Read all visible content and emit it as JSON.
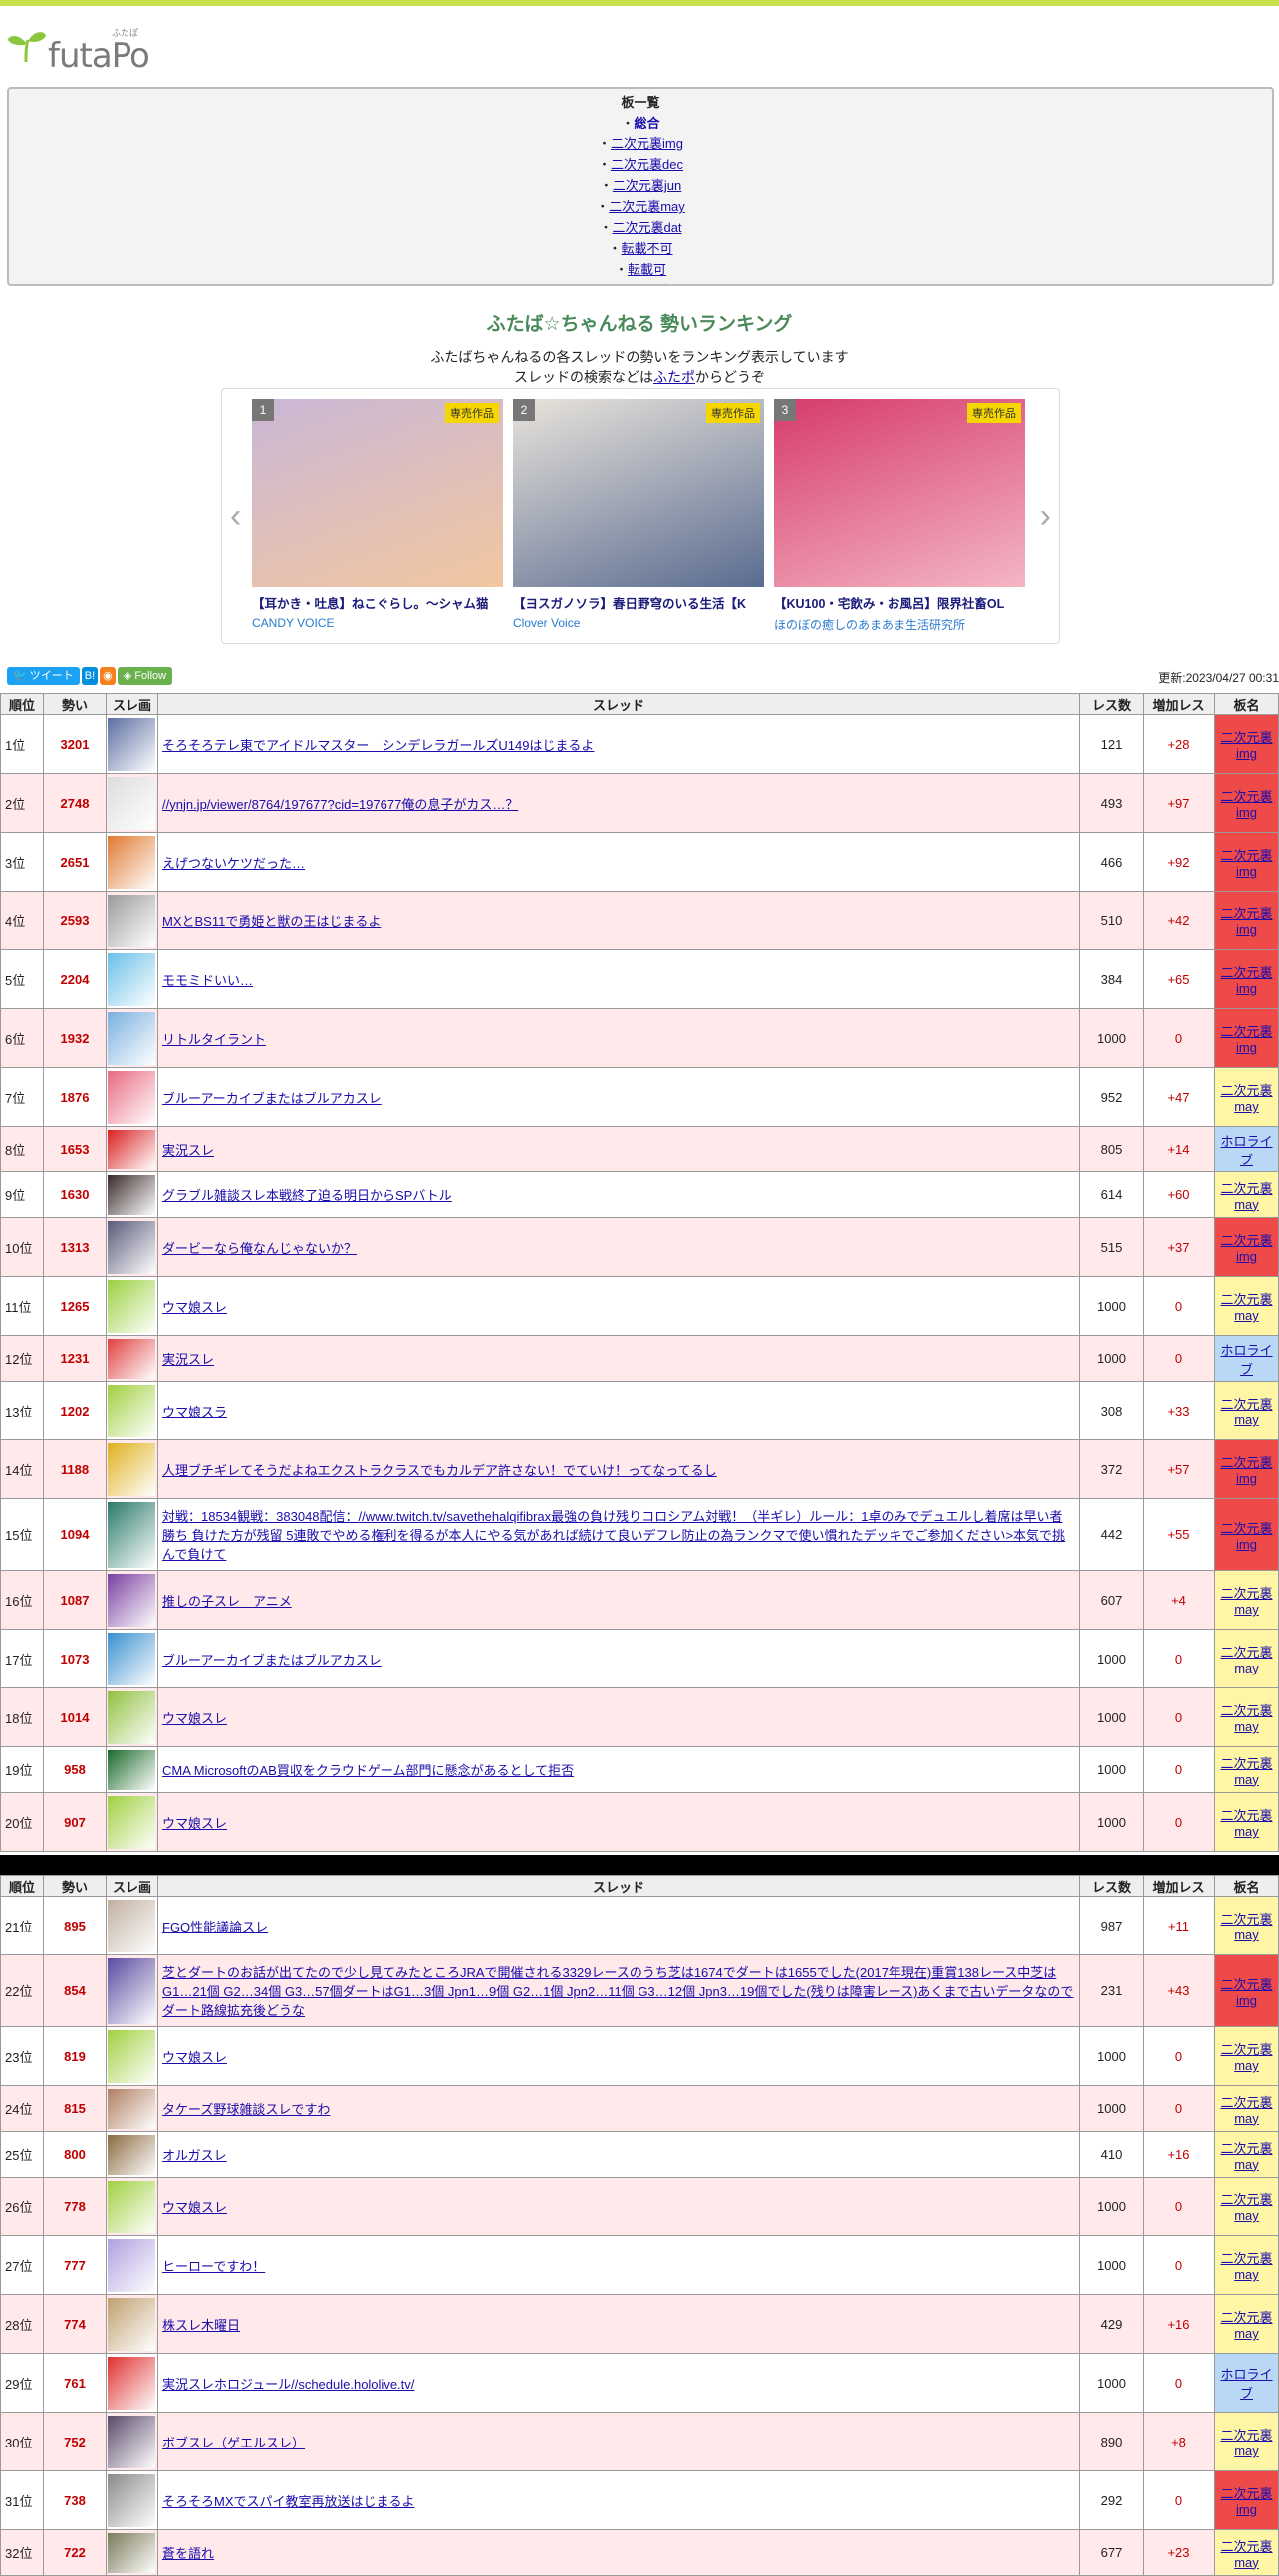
{
  "logo": {
    "text": "futaPo",
    "kana": "ふたぽ"
  },
  "boards": {
    "heading": "板一覧",
    "items": [
      "総合",
      "二次元裏img",
      "二次元裏dec",
      "二次元裏jun",
      "二次元裏may",
      "二次元裏dat",
      "転載不可",
      "転載可",
      "二次元裏"
    ]
  },
  "page": {
    "title": "ふたば☆ちゃんねる 勢いランキング",
    "sub1": "ふたばちゃんねるの各スレッドの勢いをランキング表示しています",
    "sub2_pre": "スレッドの検索などは",
    "sub2_link": "ふたポ",
    "sub2_post": "からどうぞ"
  },
  "carousel": {
    "prev": "‹",
    "next": "›",
    "items": [
      {
        "rank": "1",
        "badge": "専売作品",
        "caption": "【耳かき・吐息】ねこぐらし。～シャム猫",
        "circle": "CANDY VOICE",
        "colors": [
          "#c9b7d6",
          "#f2c6a0"
        ]
      },
      {
        "rank": "2",
        "badge": "専売作品",
        "caption": "【ヨスガノソラ】春日野穹のいる生活【K",
        "circle": "Clover Voice",
        "colors": [
          "#e9e4dc",
          "#5a6c90"
        ]
      },
      {
        "rank": "3",
        "badge": "専売作品",
        "caption": "【KU100・宅飲み・お風呂】限界社畜OL",
        "circle": "ほのぼの癒しのあまあま生活研究所",
        "colors": [
          "#d63b6b",
          "#f4b6c5"
        ]
      }
    ]
  },
  "social": {
    "tweet": "ツイート",
    "hatena": "B!",
    "rss": "RSS",
    "follow": "Follow",
    "updated": "更新:2023/04/27 00:31"
  },
  "table": {
    "headers": [
      "順位",
      "勢い",
      "スレ画",
      "スレッド",
      "レス数",
      "増加レス",
      "板名"
    ]
  },
  "rows1": [
    {
      "pos": "1位",
      "mom": "3201",
      "title": "そろそろテレ東でアイドルマスター　シンデレラガールズU149はじまるよ",
      "res": "121",
      "inc": "+28",
      "board": "二次元裏img",
      "type": "img",
      "thumb": "#5a6ea0"
    },
    {
      "pos": "2位",
      "mom": "2748",
      "title": "//ynjn.jp/viewer/8764/197677?cid=197677俺の息子がカス…？",
      "res": "493",
      "inc": "+97",
      "board": "二次元裏img",
      "type": "img",
      "thumb": "#dddddd"
    },
    {
      "pos": "3位",
      "mom": "2651",
      "title": "えげつないケツだった…",
      "res": "466",
      "inc": "+92",
      "board": "二次元裏img",
      "type": "img",
      "thumb": "#e07a30"
    },
    {
      "pos": "4位",
      "mom": "2593",
      "title": "MXとBS11で勇姫と獣の王はじまるよ",
      "res": "510",
      "inc": "+42",
      "board": "二次元裏img",
      "type": "img",
      "thumb": "#9a9a9a"
    },
    {
      "pos": "5位",
      "mom": "2204",
      "title": "モモミドいい…",
      "res": "384",
      "inc": "+65",
      "board": "二次元裏img",
      "type": "img",
      "thumb": "#6ac0e8"
    },
    {
      "pos": "6位",
      "mom": "1932",
      "title": "リトルタイラント",
      "res": "1000",
      "inc": "0",
      "board": "二次元裏img",
      "type": "img",
      "thumb": "#7ab0e0"
    },
    {
      "pos": "7位",
      "mom": "1876",
      "title": "ブルーアーカイブまたはブルアカスレ",
      "res": "952",
      "inc": "+47",
      "board": "二次元裏may",
      "type": "may",
      "thumb": "#e86a80"
    },
    {
      "pos": "8位",
      "mom": "1653",
      "title": "実況スレ",
      "res": "805",
      "inc": "+14",
      "board": "ホロライブ",
      "type": "holo",
      "thumb": "#d92020"
    },
    {
      "pos": "9位",
      "mom": "1630",
      "title": "グラブル雑談スレ本戦終了迫る明日からSPバトル",
      "res": "614",
      "inc": "+60",
      "board": "二次元裏may",
      "type": "may",
      "thumb": "#3a2a2a"
    },
    {
      "pos": "10位",
      "mom": "1313",
      "title": "ダービーなら俺なんじゃないか？",
      "res": "515",
      "inc": "+37",
      "board": "二次元裏img",
      "type": "img",
      "thumb": "#5a5a7a"
    },
    {
      "pos": "11位",
      "mom": "1265",
      "title": "ウマ娘スレ",
      "res": "1000",
      "inc": "0",
      "board": "二次元裏may",
      "type": "may",
      "thumb": "#9ad040"
    },
    {
      "pos": "12位",
      "mom": "1231",
      "title": "実況スレ",
      "res": "1000",
      "inc": "0",
      "board": "ホロライブ",
      "type": "holo",
      "thumb": "#e04040"
    },
    {
      "pos": "13位",
      "mom": "1202",
      "title": "ウマ娘スラ",
      "res": "308",
      "inc": "+33",
      "board": "二次元裏may",
      "type": "may",
      "thumb": "#a0d040"
    },
    {
      "pos": "14位",
      "mom": "1188",
      "title": "人理ブチギレてそうだよねエクストラクラスでもカルデア許さない！でていけ！ってなってるし",
      "res": "372",
      "inc": "+57",
      "board": "二次元裏img",
      "type": "img",
      "thumb": "#e0b020"
    },
    {
      "pos": "15位",
      "mom": "1094",
      "title": "対戦：18534観戦：383048配信：//www.twitch.tv/savethehalqifibrax最強の負け残りコロシアム対戦！（半ギレ）ルール：1卓のみでデュエルし着席は早い者勝ち 負けた方が残留 5連敗でやめる権利を得るが本人にやる気があれば続けて良いデフレ防止の為ランクマで使い慣れたデッキでご参加ください>本気で挑んで負けて",
      "res": "442",
      "inc": "+55",
      "board": "二次元裏img",
      "type": "img",
      "thumb": "#2a7a6a"
    },
    {
      "pos": "16位",
      "mom": "1087",
      "title": "推しの子スレ　アニメ",
      "res": "607",
      "inc": "+4",
      "board": "二次元裏may",
      "type": "may",
      "thumb": "#7a40a0"
    },
    {
      "pos": "17位",
      "mom": "1073",
      "title": "ブルーアーカイブまたはブルアカスレ",
      "res": "1000",
      "inc": "0",
      "board": "二次元裏may",
      "type": "may",
      "thumb": "#3a90d0"
    },
    {
      "pos": "18位",
      "mom": "1014",
      "title": "ウマ娘スレ",
      "res": "1000",
      "inc": "0",
      "board": "二次元裏may",
      "type": "may",
      "thumb": "#90c040"
    },
    {
      "pos": "19位",
      "mom": "958",
      "title": "CMA MicrosoftのAB買収をクラウドゲーム部門に懸念があるとして拒否",
      "res": "1000",
      "inc": "0",
      "board": "二次元裏may",
      "type": "may",
      "thumb": "#1a6a2a"
    },
    {
      "pos": "20位",
      "mom": "907",
      "title": "ウマ娘スレ",
      "res": "1000",
      "inc": "0",
      "board": "二次元裏may",
      "type": "may",
      "thumb": "#a0d040"
    }
  ],
  "rows2": [
    {
      "pos": "21位",
      "mom": "895",
      "title": "FGO性能議論スレ",
      "res": "987",
      "inc": "+11",
      "board": "二次元裏may",
      "type": "may",
      "thumb": "#c0b0a0"
    },
    {
      "pos": "22位",
      "mom": "854",
      "title": "芝とダートのお話が出てたので少し見てみたところJRAで開催される3329レースのうち芝は1674でダートは1655でした(2017年現在)重賞138レース中芝はG1…21個 G2…34個 G3…57個ダートはG1…3個 Jpn1…9個 G2…1個 Jpn2…11個 G3…12個 Jpn3…19個でした(残りは障害レース)あくまで古いデータなのでダート路線拡充後どうな",
      "res": "231",
      "inc": "+43",
      "board": "二次元裏img",
      "type": "img",
      "thumb": "#5a4aa0"
    },
    {
      "pos": "23位",
      "mom": "819",
      "title": "ウマ娘スレ",
      "res": "1000",
      "inc": "0",
      "board": "二次元裏may",
      "type": "may",
      "thumb": "#a0d040"
    },
    {
      "pos": "24位",
      "mom": "815",
      "title": "タケーズ野球雑談スレですわ",
      "res": "1000",
      "inc": "0",
      "board": "二次元裏may",
      "type": "may",
      "thumb": "#b08060"
    },
    {
      "pos": "25位",
      "mom": "800",
      "title": "オルガスレ",
      "res": "410",
      "inc": "+16",
      "board": "二次元裏may",
      "type": "may",
      "thumb": "#8a6a40"
    },
    {
      "pos": "26位",
      "mom": "778",
      "title": "ウマ娘スレ",
      "res": "1000",
      "inc": "0",
      "board": "二次元裏may",
      "type": "may",
      "thumb": "#a0d040"
    },
    {
      "pos": "27位",
      "mom": "777",
      "title": "ヒーローですわ！",
      "res": "1000",
      "inc": "0",
      "board": "二次元裏may",
      "type": "may",
      "thumb": "#b0a0e0"
    },
    {
      "pos": "28位",
      "mom": "774",
      "title": "株スレ木曜日",
      "res": "429",
      "inc": "+16",
      "board": "二次元裏may",
      "type": "may",
      "thumb": "#c0a070"
    },
    {
      "pos": "29位",
      "mom": "761",
      "title": "実況スレホロジュール//schedule.hololive.tv/",
      "res": "1000",
      "inc": "0",
      "board": "ホロライブ",
      "type": "holo",
      "thumb": "#e03030"
    },
    {
      "pos": "30位",
      "mom": "752",
      "title": "ボブスレ（ゲエルスレ）",
      "res": "890",
      "inc": "+8",
      "board": "二次元裏may",
      "type": "may",
      "thumb": "#5a4a6a"
    },
    {
      "pos": "31位",
      "mom": "738",
      "title": "そろそろMXでスパイ教室再放送はじまるよ",
      "res": "292",
      "inc": "0",
      "board": "二次元裏img",
      "type": "img",
      "thumb": "#8a8a8a"
    },
    {
      "pos": "32位",
      "mom": "722",
      "title": "蒼を語れ",
      "res": "677",
      "inc": "+23",
      "board": "二次元裏may",
      "type": "may",
      "thumb": "#7a7a5a"
    }
  ]
}
